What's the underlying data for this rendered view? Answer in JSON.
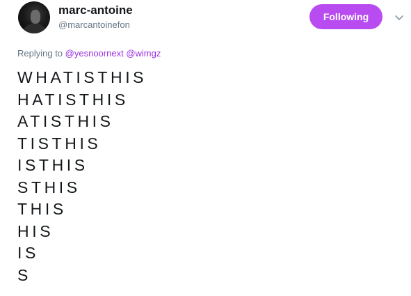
{
  "author": {
    "display_name": "marc-antoine",
    "handle": "@marcantoinefon"
  },
  "follow_button": {
    "label": "Following",
    "color": "#b94cf0"
  },
  "more_menu": {
    "icon": "chevron-down-icon"
  },
  "reply": {
    "prefix": "Replying to",
    "mentions": [
      "@yesnoornext",
      "@wimgz"
    ],
    "mention_color": "#9b30e0"
  },
  "tweet": {
    "lines": [
      "WHATISTHIS",
      "HATISTHIS",
      "ATISTHIS",
      "TISTHIS",
      "ISTHIS",
      "STHIS",
      "THIS",
      "HIS",
      "IS",
      "S"
    ]
  }
}
